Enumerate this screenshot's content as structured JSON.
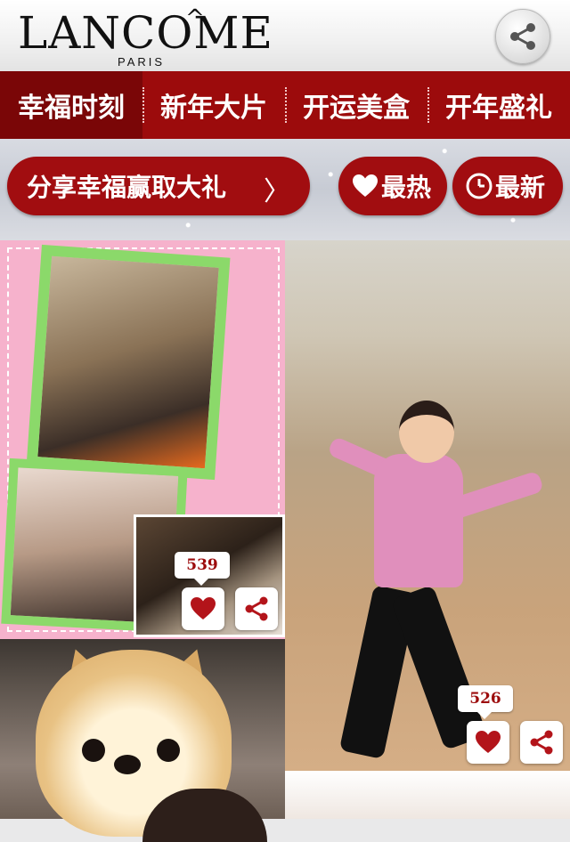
{
  "brand": {
    "name": "LANCÔME",
    "name_base": "LANCOME",
    "circumflex": "^",
    "sub": "PARIS"
  },
  "tabs": [
    {
      "label": "幸福时刻",
      "active": true
    },
    {
      "label": "新年大片"
    },
    {
      "label": "开运美盒"
    },
    {
      "label": "开年盛礼"
    }
  ],
  "promo": {
    "label": "分享幸福赢取大礼",
    "arrow": "〉"
  },
  "filters": {
    "hot_label": "最热",
    "new_label": "最新"
  },
  "posts": [
    {
      "likes": "539"
    },
    {
      "likes": "526"
    }
  ],
  "colors": {
    "brand_red": "#9c0b0c",
    "tab_active": "#7a0607",
    "pill_red": "#a10d10"
  },
  "icons": [
    "share-icon",
    "heart-icon",
    "clock-icon"
  ]
}
